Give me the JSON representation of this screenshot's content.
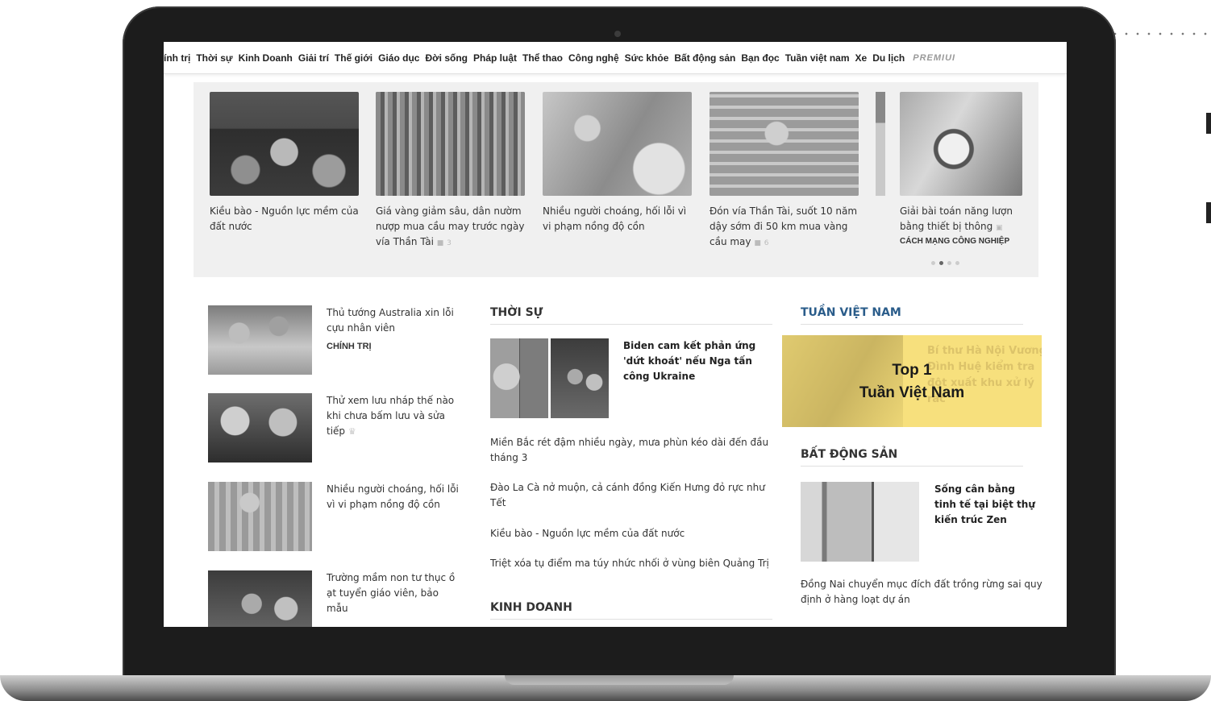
{
  "nav": {
    "items": [
      "ính trị",
      "Thời sự",
      "Kinh Doanh",
      "Giải trí",
      "Thế giới",
      "Giáo dục",
      "Đời sống",
      "Pháp luật",
      "Thể thao",
      "Công nghệ",
      "Sức khỏe",
      "Bất động sản",
      "Bạn đọc",
      "Tuần việt nam",
      "Xe",
      "Du lịch"
    ],
    "premium": "PREMIUI"
  },
  "featured": [
    {
      "title": "Kiều bào - Nguồn lực mềm của đất nước",
      "comments": ""
    },
    {
      "title": "Giá vàng giảm sâu, dân nườm nượp mua cầu may trước ngày vía Thần Tài",
      "comments": "3"
    },
    {
      "title": "Nhiều người choáng, hối lỗi vì vi phạm nồng độ cồn",
      "comments": ""
    },
    {
      "title": "Đón vía Thần Tài, suốt 10 năm dậy sớm đi 50 km mua vàng cầu may",
      "comments": "6"
    },
    {
      "title": "Giải bài toán năng lượn bằng thiết bị thông",
      "comments": "",
      "category": "CÁCH MẠNG CÔNG NGHIỆP"
    }
  ],
  "left_list": [
    {
      "title": "Thủ tướng Australia xin lỗi cựu nhân viên",
      "category": "CHÍNH TRỊ"
    },
    {
      "title": "Thử xem lưu nháp thế nào khi chưa bấm lưu và sửa tiếp",
      "category": ""
    },
    {
      "title": "Nhiều người choáng, hối lỗi vì vi phạm nồng độ cồn",
      "category": ""
    },
    {
      "title": "Trường mầm non tư thục ồ ạt tuyển giáo viên, bảo mẫu",
      "category": ""
    }
  ],
  "thoi_su": {
    "heading": "THỜI SỰ",
    "lead_title": "Biden cam kết phản ứng 'dứt khoát' nếu Nga tấn công Ukraine",
    "links": [
      "Miền Bắc rét đậm nhiều ngày, mưa phùn kéo dài đến đầu tháng 3",
      "Đào La Cà nở muộn, cả cánh đồng Kiến Hưng đỏ rực như Tết",
      "Kiều bào - Nguồn lực mềm của đất nước",
      "Triệt xóa tụ điểm ma túy nhức nhối ở vùng biên Quảng Trị"
    ]
  },
  "kinh_doanh": {
    "heading": "KINH DOANH"
  },
  "tuan_viet_nam": {
    "heading": "TUẦN VIỆT NAM",
    "banner_top": "Top 1",
    "banner_name": "Tuần Việt Nam",
    "banner_ghost": "Bí thư Hà Nội Vương Đình Huệ kiểm tra đột xuất khu xử lý rác"
  },
  "bat_dong_san": {
    "heading": "BẤT ĐỘNG SẢN",
    "lead_title": "Sống cân bằng tinh tế tại biệt thự kiến trúc Zen",
    "link": "Đồng Nai chuyển mục đích đất trồng rừng sai quy định ở hàng loạt dự án"
  }
}
